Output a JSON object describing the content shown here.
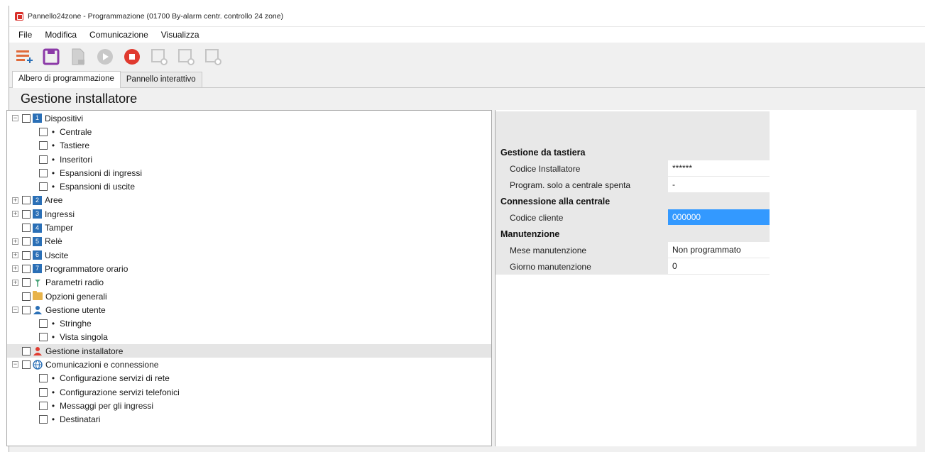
{
  "window": {
    "title": "Pannello24zone - Programmazione (01700  By-alarm centr. controllo 24 zone)"
  },
  "menu": [
    "File",
    "Modifica",
    "Comunicazione",
    "Visualizza"
  ],
  "toolbar": {
    "icons": [
      "add-list-icon",
      "save-icon",
      "document-icon",
      "play-icon",
      "stop-icon",
      "device-icon",
      "device-icon",
      "device-icon"
    ]
  },
  "tabs": [
    {
      "label": "Albero di programmazione",
      "active": true
    },
    {
      "label": "Pannello interattivo",
      "active": false
    }
  ],
  "panel_title": "Gestione installatore",
  "tree": [
    {
      "label": "Dispositivi",
      "level": 0,
      "expander": "⊟",
      "icon": "1"
    },
    {
      "label": "Centrale",
      "level": 1,
      "bullet": true
    },
    {
      "label": "Tastiere",
      "level": 1,
      "bullet": true
    },
    {
      "label": "Inseritori",
      "level": 1,
      "bullet": true
    },
    {
      "label": "Espansioni di ingressi",
      "level": 1,
      "bullet": true
    },
    {
      "label": "Espansioni di uscite",
      "level": 1,
      "bullet": true
    },
    {
      "label": "Aree",
      "level": 0,
      "expander": "⊞",
      "icon": "2"
    },
    {
      "label": "Ingressi",
      "level": 0,
      "expander": "⊞",
      "icon": "3"
    },
    {
      "label": "Tamper",
      "level": 0,
      "expander": "",
      "icon": "4"
    },
    {
      "label": "Relè",
      "level": 0,
      "expander": "⊞",
      "icon": "5"
    },
    {
      "label": "Uscite",
      "level": 0,
      "expander": "⊞",
      "icon": "6"
    },
    {
      "label": "Programmatore orario",
      "level": 0,
      "expander": "⊞",
      "icon": "7"
    },
    {
      "label": "Parametri radio",
      "level": 0,
      "expander": "⊞",
      "icon": "antenna"
    },
    {
      "label": "Opzioni generali",
      "level": 0,
      "expander": "",
      "icon": "folder"
    },
    {
      "label": "Gestione utente",
      "level": 0,
      "expander": "⊟",
      "icon": "user"
    },
    {
      "label": "Stringhe",
      "level": 1,
      "bullet": true
    },
    {
      "label": "Vista singola",
      "level": 1,
      "bullet": true
    },
    {
      "label": "Gestione installatore",
      "level": 0,
      "expander": "",
      "icon": "installer",
      "selected": true
    },
    {
      "label": "Comunicazioni e connessione",
      "level": 0,
      "expander": "⊟",
      "icon": "globe"
    },
    {
      "label": "Configurazione servizi di rete",
      "level": 1,
      "bullet": true
    },
    {
      "label": "Configurazione servizi telefonici",
      "level": 1,
      "bullet": true
    },
    {
      "label": "Messaggi per gli ingressi",
      "level": 1,
      "bullet": true
    },
    {
      "label": "Destinatari",
      "level": 1,
      "bullet": true
    }
  ],
  "properties": [
    {
      "category": "Gestione da tastiera",
      "rows": [
        {
          "key": "Codice Installatore",
          "value": "******"
        },
        {
          "key": "Program. solo a centrale spenta",
          "value": "-"
        }
      ]
    },
    {
      "category": "Connessione alla centrale",
      "rows": [
        {
          "key": "Codice cliente",
          "value": "000000",
          "selected": true
        }
      ]
    },
    {
      "category": "Manutenzione",
      "rows": [
        {
          "key": "Mese manutenzione",
          "value": "Non programmato"
        },
        {
          "key": "Giorno manutenzione",
          "value": "0"
        }
      ]
    }
  ],
  "colors": {
    "accent_blue": "#2a6fb6",
    "selection_blue": "#3399ff",
    "stop_red": "#e03a2f",
    "save_purple": "#8c3aa8"
  }
}
